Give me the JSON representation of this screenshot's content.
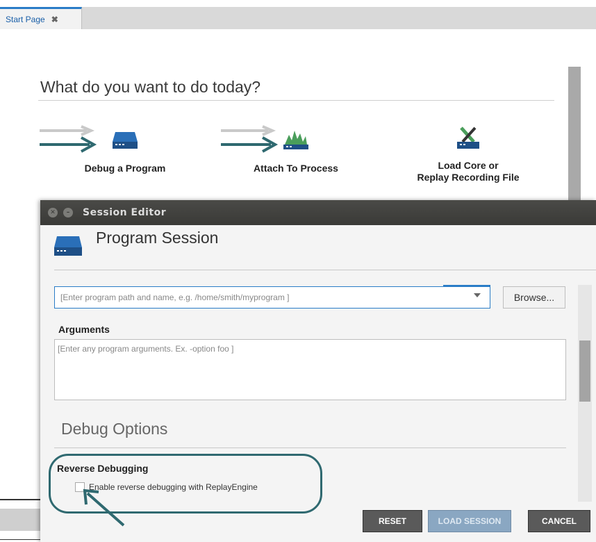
{
  "tabs": [
    {
      "label": "Start Page",
      "close": "✖"
    }
  ],
  "start_page": {
    "heading": "What do you want to do today?",
    "actions": [
      {
        "line1": "Debug a Program",
        "line2": "",
        "icon": "drive-icon"
      },
      {
        "line1": "Attach To Process",
        "line2": "",
        "icon": "process-graph-icon"
      },
      {
        "line1": "Load Core or",
        "line2": "Replay Recording File",
        "icon": "tools-drive-icon"
      }
    ]
  },
  "dialog": {
    "title": "Session Editor",
    "session_title": "Program Session",
    "program_placeholder": "[Enter program path and name, e.g. /home/smith/myprogram ]",
    "browse_label": "Browse...",
    "arguments_label": "Arguments",
    "arguments_placeholder": "[Enter any program arguments. Ex. -option foo ]",
    "debug_options_title": "Debug Options",
    "reverse_debugging_label": "Reverse Debugging",
    "enable_reverse_label": "Enable reverse debugging with ReplayEngine",
    "enable_reverse_checked": false,
    "buttons": {
      "reset": "RESET",
      "load": "LOAD SESSION",
      "cancel": "CANCEL"
    }
  },
  "colors": {
    "accent": "#2a7cc7",
    "annotation": "#2f6970",
    "titlebar": "#3f3f3c",
    "button_dark": "#5a5a5a",
    "button_disabled": "#8aa7c2"
  }
}
